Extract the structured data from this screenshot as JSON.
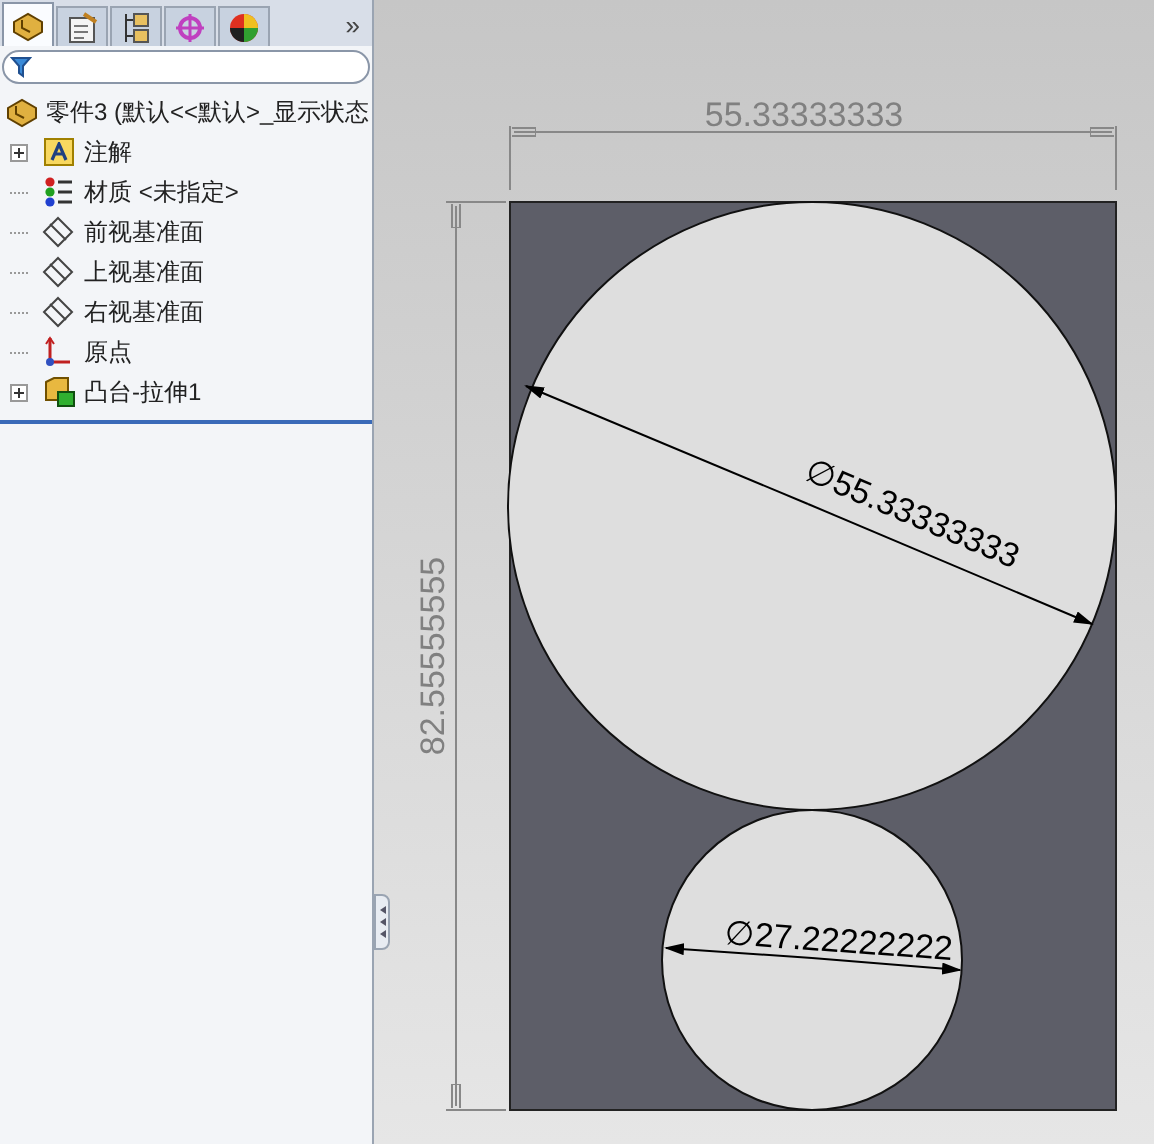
{
  "panel": {
    "tabs": [
      {
        "kind": "feature",
        "selected": true
      },
      {
        "kind": "property",
        "selected": false
      },
      {
        "kind": "config",
        "selected": false
      },
      {
        "kind": "target",
        "selected": false
      },
      {
        "kind": "appearance",
        "selected": false
      }
    ],
    "more": "»",
    "tree": {
      "label": "零件3  (默认<<默认>_显示状态",
      "children": [
        {
          "kind": "annotation",
          "label": "注解",
          "expandable": true
        },
        {
          "kind": "material",
          "label": "材质 <未指定>",
          "expandable": false
        },
        {
          "kind": "plane",
          "label": "前视基准面",
          "expandable": false
        },
        {
          "kind": "plane",
          "label": "上视基准面",
          "expandable": false
        },
        {
          "kind": "plane",
          "label": "右视基准面",
          "expandable": false
        },
        {
          "kind": "origin",
          "label": "原点",
          "expandable": false
        },
        {
          "kind": "extrude",
          "label": "凸台-拉伸1",
          "expandable": true
        }
      ]
    }
  },
  "sketch": {
    "width_dimension": "55.33333333",
    "height_dimension": "82.55555555",
    "large_diameter": "∅55.33333333",
    "small_diameter": "∅27.22222222"
  }
}
